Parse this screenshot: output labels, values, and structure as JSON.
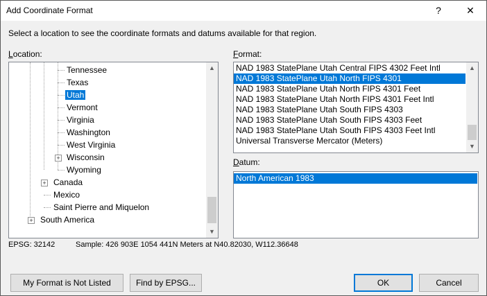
{
  "window": {
    "title": "Add Coordinate Format",
    "help": "?",
    "close": "✕"
  },
  "instruction": "Select a location to see the coordinate formats and datums available for that region.",
  "location": {
    "label_ul": "L",
    "label_rest": "ocation:",
    "items": [
      "Tennessee",
      "Texas",
      "Utah",
      "Vermont",
      "Virginia",
      "Washington",
      "West Virginia",
      "Wisconsin",
      "Wyoming",
      "Canada",
      "Mexico",
      "Saint Pierre and Miquelon",
      "South America"
    ],
    "selected": "Utah"
  },
  "format": {
    "label_ul": "F",
    "label_rest": "ormat:",
    "items": [
      "NAD 1983 StatePlane Utah Central FIPS 4302 Feet Intl",
      "NAD 1983 StatePlane Utah North FIPS 4301",
      "NAD 1983 StatePlane Utah North FIPS 4301 Feet",
      "NAD 1983 StatePlane Utah North FIPS 4301 Feet Intl",
      "NAD 1983 StatePlane Utah South FIPS 4303",
      "NAD 1983 StatePlane Utah South FIPS 4303 Feet",
      "NAD 1983 StatePlane Utah South FIPS 4303 Feet Intl",
      "Universal Transverse Mercator (Meters)"
    ],
    "selected_index": 1
  },
  "datum": {
    "label_ul": "D",
    "label_rest": "atum:",
    "items": [
      "North American 1983"
    ]
  },
  "status": {
    "epsg": "EPSG: 32142",
    "sample": "Sample: 426 903E  1054 441N Meters at N40.82030, W112.36648"
  },
  "buttons": {
    "not_listed": "My Format is Not Listed",
    "find_epsg": "Find by EPSG...",
    "ok": "OK",
    "cancel": "Cancel"
  },
  "icons": {
    "up": "▲",
    "down": "▼",
    "plus": "+"
  }
}
